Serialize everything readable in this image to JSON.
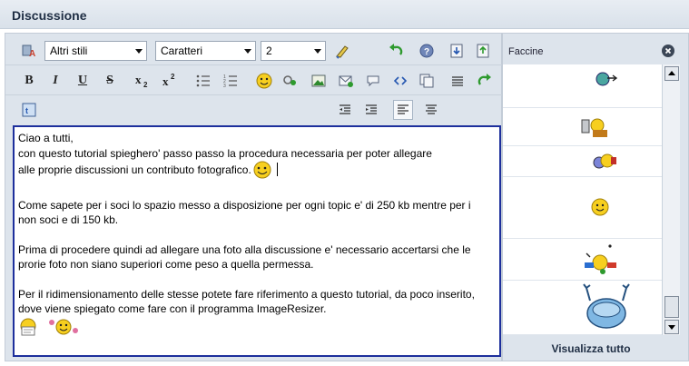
{
  "header": {
    "title": "Discussione"
  },
  "toolbar": {
    "style_select": {
      "value": "Altri stili"
    },
    "font_select": {
      "value": "Caratteri"
    },
    "size_select": {
      "value": "2"
    }
  },
  "editor": {
    "lines": [
      "Ciao a tutti,",
      "con questo tutorial spieghero' passo passo la procedura necessaria per poter allegare",
      "alle proprie discussioni un contributo fotografico.",
      "",
      "Come sapete per i soci lo spazio messo a disposizione per ogni topic e' di 250 kb mentre per i",
      "non soci e di 150 kb.",
      "",
      "Prima di procedere quindi ad allegare una foto alla discussione e' necessario accertarsi che le",
      "prorie foto non siano superiori come peso a quella permessa.",
      "",
      "Per il ridimensionamento delle stesse potete fare riferimento a questo tutorial, da poco inserito,",
      "dove viene spiegato come fare con il programma ImageResizer."
    ]
  },
  "smilies": {
    "title": "Faccine",
    "view_all_label": "Visualizza tutto"
  },
  "colors": {
    "accent_border": "#1d2f9c",
    "panel_bg": "#dde4ec",
    "smiley_yellow": "#f7cf1f"
  }
}
